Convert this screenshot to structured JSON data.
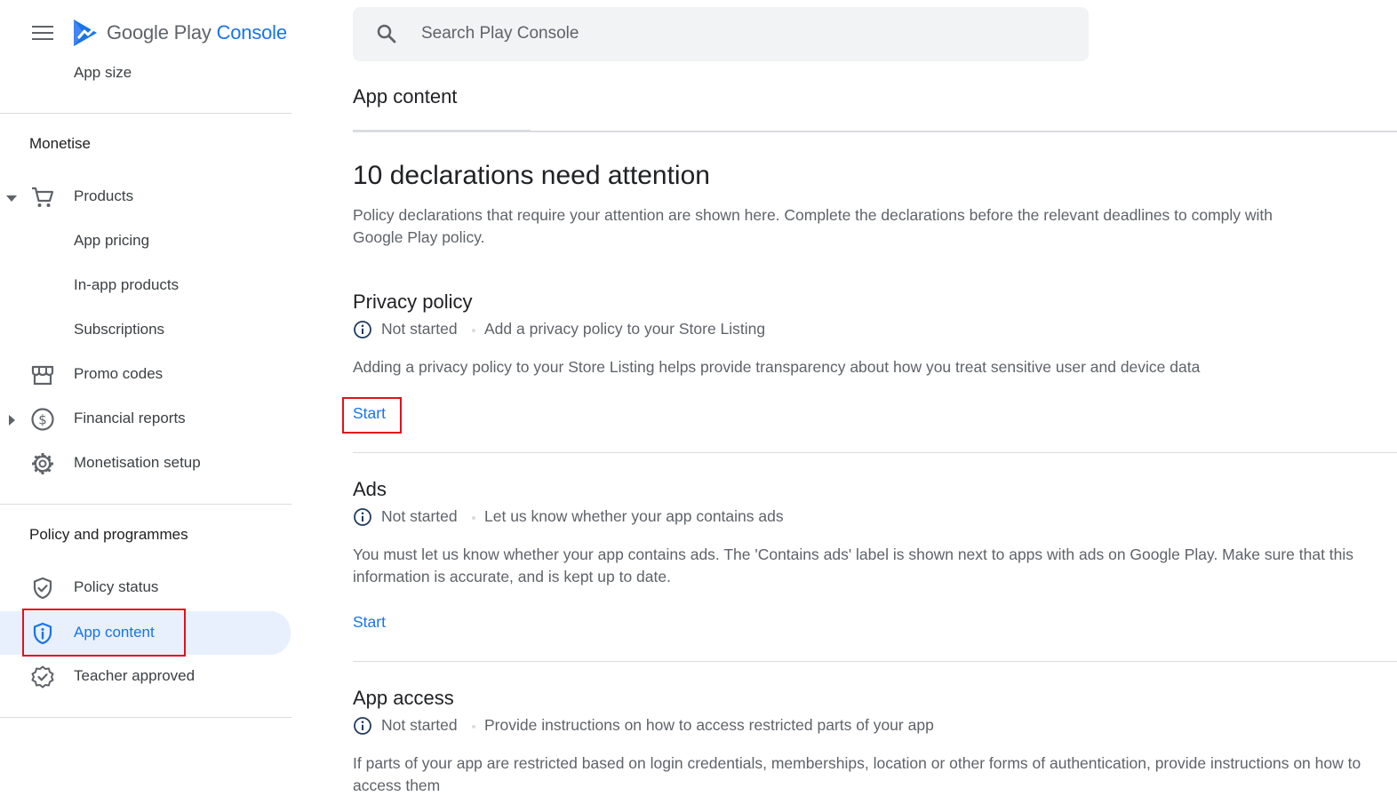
{
  "header": {
    "brand_main": "Google Play",
    "brand_accent": "Console",
    "search_placeholder": "Search Play Console"
  },
  "sidebar": {
    "partial_item": "App size",
    "sections": [
      {
        "title": "Monetise",
        "items": [
          {
            "label": "Products",
            "icon": "cart-icon",
            "caret": "down"
          },
          {
            "label": "App pricing"
          },
          {
            "label": "In-app products"
          },
          {
            "label": "Subscriptions"
          },
          {
            "label": "Promo codes",
            "icon": "store-icon"
          },
          {
            "label": "Financial reports",
            "icon": "dollar-icon",
            "caret": "right"
          },
          {
            "label": "Monetisation setup",
            "icon": "gear-icon"
          }
        ]
      },
      {
        "title": "Policy and programmes",
        "items": [
          {
            "label": "Policy status",
            "icon": "shield-check-icon"
          },
          {
            "label": "App content",
            "icon": "shield-info-icon",
            "active": true
          },
          {
            "label": "Teacher approved",
            "icon": "badge-check-icon"
          }
        ]
      }
    ]
  },
  "main": {
    "page_title": "App content",
    "headline": "10 declarations need attention",
    "intro": "Policy declarations that require your attention are shown here. Complete the declarations before the relevant deadlines to comply with Google Play policy.",
    "declarations": [
      {
        "title": "Privacy policy",
        "status": "Not started",
        "summary": "Add a privacy policy to your Store Listing",
        "description": "Adding a privacy policy to your Store Listing helps provide transparency about how you treat sensitive user and device data",
        "action": "Start"
      },
      {
        "title": "Ads",
        "status": "Not started",
        "summary": "Let us know whether your app contains ads",
        "description": "You must let us know whether your app contains ads. The 'Contains ads' label is shown next to apps with ads on Google Play. Make sure that this information is accurate, and is kept up to date.",
        "action": "Start"
      },
      {
        "title": "App access",
        "status": "Not started",
        "summary": "Provide instructions on how to access restricted parts of your app",
        "description": "If parts of your app are restricted based on login credentials, memberships, location or other forms of authentication, provide instructions on how to access them"
      }
    ]
  },
  "colors": {
    "accent": "#1a73e8",
    "active_bg": "#e8f0fe",
    "highlight": "#e0121b"
  }
}
